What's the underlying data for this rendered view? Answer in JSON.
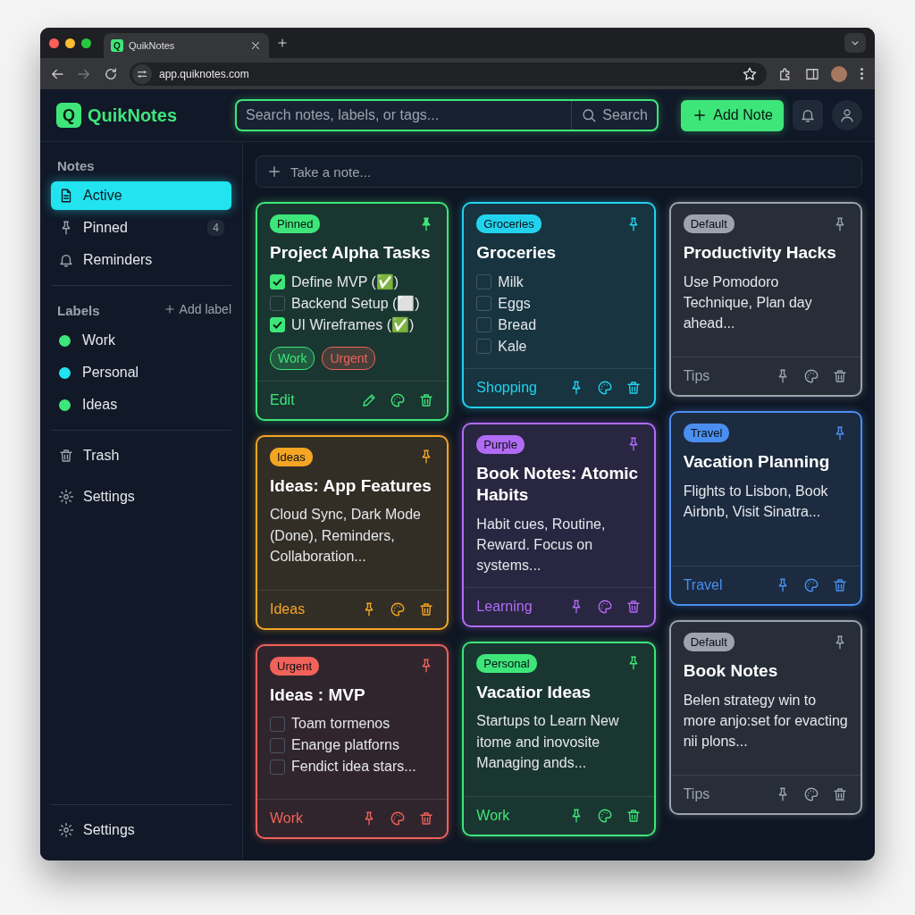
{
  "browser": {
    "favicon": "Q",
    "tab_title": "QuikNotes",
    "url": "app.quiknotes.com"
  },
  "header": {
    "logo": "Q",
    "app_name": "QuikNotes",
    "search": {
      "placeholder": "Search notes, labels, or tags...",
      "button": "Search"
    },
    "add_button": "Add Note"
  },
  "sidebar": {
    "notes_heading": "Notes",
    "items": [
      {
        "label": "Active",
        "selected": true
      },
      {
        "label": "Pinned",
        "count": "4",
        "selected": false
      },
      {
        "label": "Reminders",
        "selected": false
      }
    ],
    "labels_heading": "Labels",
    "add_label": "Add label",
    "labels": [
      {
        "label": "Work",
        "color": "#3ee67a"
      },
      {
        "label": "Personal",
        "color": "#22e4f0"
      },
      {
        "label": "Ideas",
        "color": "#3ee67a"
      }
    ],
    "extra": [
      {
        "label": "Trash"
      },
      {
        "label": "Settings"
      }
    ],
    "footer": {
      "label": "Settings"
    }
  },
  "take_note": {
    "placeholder": "Take a note..."
  },
  "columns": [
    [
      {
        "badge": "Pinned",
        "color": "#3ee67a",
        "pinned": true,
        "title": "Project Alpha Tasks",
        "kind": "checklist",
        "items": [
          {
            "text": "Define MVP (✅)",
            "checked": true
          },
          {
            "text": "Backend Setup (⬜)",
            "checked": false
          },
          {
            "text": "UI Wireframes (✅)",
            "checked": true
          }
        ],
        "tags": [
          {
            "label": "Work",
            "color": "#3ee67a"
          },
          {
            "label": "Urgent",
            "color": "#f0625a"
          }
        ],
        "footer": {
          "label": "Edit",
          "kind": "edit"
        }
      },
      {
        "badge": "Ideas",
        "color": "#f5a524",
        "pinned": false,
        "title": "Ideas: App Features",
        "kind": "text",
        "body": "Cloud Sync, Dark Mode (Done), Reminders, Collaboration...",
        "footer": {
          "label": "Ideas",
          "kind": "pin"
        }
      },
      {
        "badge": "Urgent",
        "color": "#f0625a",
        "pinned": false,
        "title": "Ideas : MVP",
        "kind": "checklist",
        "items": [
          {
            "text": "Toam tormenos",
            "checked": false
          },
          {
            "text": "Enange platforns",
            "checked": false
          },
          {
            "text": "Fendict idea stars...",
            "checked": false
          }
        ],
        "footer": {
          "label": "Work",
          "kind": "pin"
        }
      }
    ],
    [
      {
        "badge": "Groceries",
        "color": "#22d3ee",
        "pinned": false,
        "title": "Groceries",
        "kind": "checklist",
        "items": [
          {
            "text": "Milk",
            "checked": false
          },
          {
            "text": "Eggs",
            "checked": false
          },
          {
            "text": "Bread",
            "checked": false
          },
          {
            "text": "Kale",
            "checked": false
          }
        ],
        "footer": {
          "label": "Shopping",
          "kind": "pin"
        }
      },
      {
        "badge": "Purple",
        "color": "#b06cf5",
        "pinned": false,
        "title": "Book Notes: Atomic Habits",
        "kind": "text",
        "body": "Habit cues, Routine, Reward. Focus on systems...",
        "footer": {
          "label": "Learning",
          "kind": "pin"
        }
      },
      {
        "badge": "Personal",
        "color": "#3ee67a",
        "pinned": false,
        "title": "Vacatior Ideas",
        "kind": "text",
        "body": "Startups to Learn New itome and inovosite Managing ands...",
        "footer": {
          "label": "Work",
          "kind": "pin"
        }
      }
    ],
    [
      {
        "badge": "Default",
        "color": "#9ca3af",
        "pinned": false,
        "title": "Productivity Hacks",
        "kind": "text",
        "body": "Use Pomodoro Technique, Plan day ahead...",
        "footer": {
          "label": "Tips",
          "kind": "pin"
        }
      },
      {
        "badge": "Travel",
        "color": "#4a8ff0",
        "pinned": false,
        "title": "Vacation Planning",
        "kind": "text",
        "body": "Flights to Lisbon, Book Airbnb, Visit Sinatra...",
        "footer": {
          "label": "Travel",
          "kind": "pin"
        }
      },
      {
        "badge": "Default",
        "color": "#9ca3af",
        "pinned": false,
        "title": "Book Notes",
        "kind": "text",
        "body": "Belen strategy win to more anjo:set for evacting nii plons...",
        "footer": {
          "label": "Tips",
          "kind": "pin"
        }
      }
    ]
  ]
}
